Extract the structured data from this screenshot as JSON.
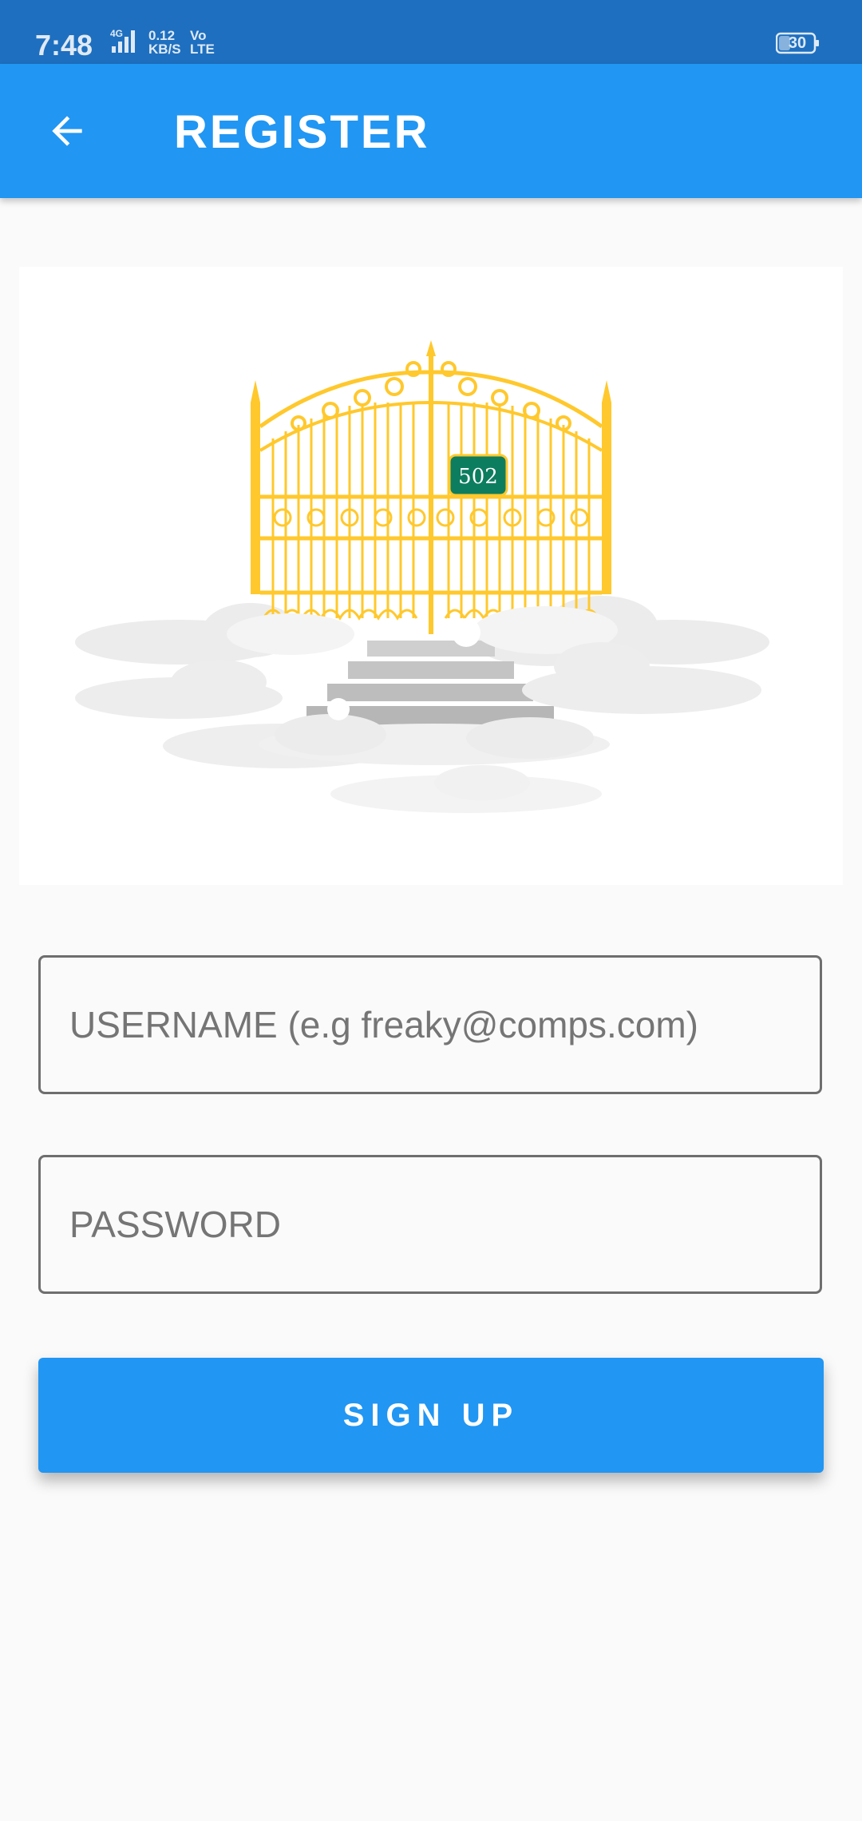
{
  "status_bar": {
    "time": "7:48",
    "network": "4G",
    "speed_value": "0.12",
    "speed_unit": "KB/S",
    "volte_top": "Vo",
    "volte_bottom": "LTE",
    "battery": "30"
  },
  "app_bar": {
    "title": "REGISTER",
    "back_icon": "arrow-left-icon"
  },
  "hero": {
    "gate_sign": "502"
  },
  "form": {
    "username_placeholder": "USERNAME (e.g freaky@comps.com)",
    "password_placeholder": "PASSWORD",
    "signup_label": "SIGN UP"
  },
  "colors": {
    "primary": "#2196f3",
    "status_bar": "#1e6fbf",
    "gate_gold": "#ffc82c",
    "sign_green": "#0d7d5f"
  }
}
